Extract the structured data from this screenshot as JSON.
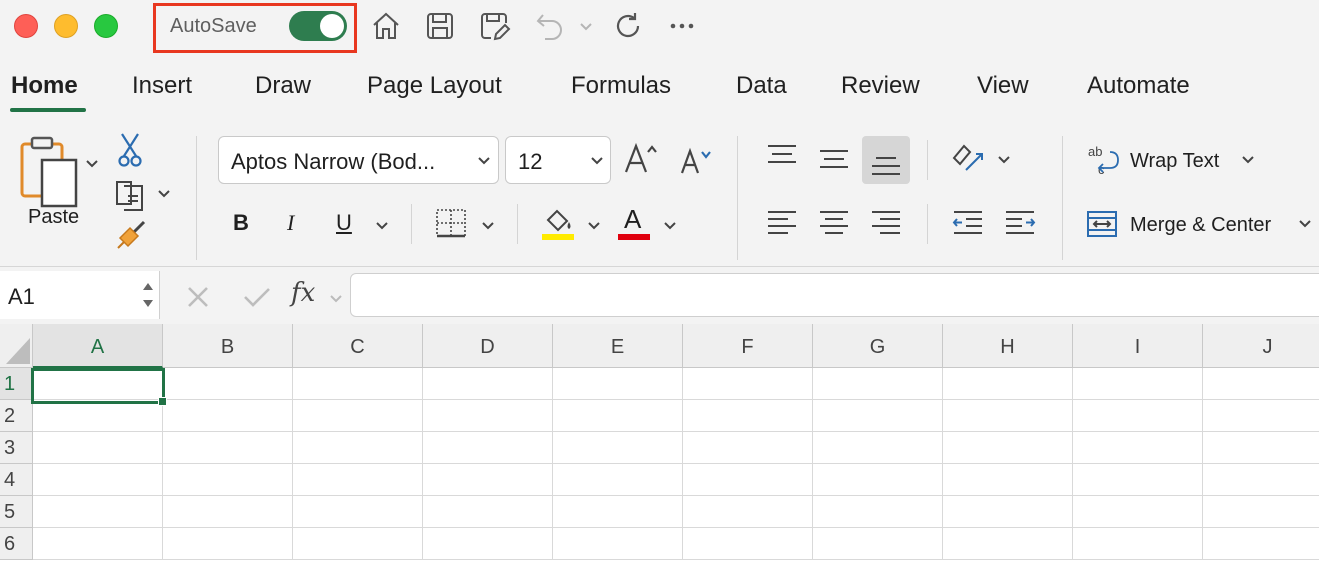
{
  "titlebar": {
    "autosave_label": "AutoSave",
    "autosave_on": true,
    "icons": [
      "home-icon",
      "save-icon",
      "save-as-icon",
      "undo-icon",
      "redo-icon",
      "more-icon"
    ]
  },
  "tabs": [
    "Home",
    "Insert",
    "Draw",
    "Page Layout",
    "Formulas",
    "Data",
    "Review",
    "View",
    "Automate"
  ],
  "ribbon": {
    "paste_label": "Paste",
    "font_name": "Aptos Narrow (Bod...",
    "font_size": "12",
    "bold": "B",
    "italic": "I",
    "underline": "U",
    "font_color_glyph": "A",
    "wrap_text_label": "Wrap Text",
    "merge_center_label": "Merge & Center",
    "fill_color": "#ffeb00",
    "font_color": "#e0000e"
  },
  "formula_bar": {
    "name_box": "A1",
    "fx_label": "fx",
    "formula": ""
  },
  "grid": {
    "columns": [
      "A",
      "B",
      "C",
      "D",
      "E",
      "F",
      "G",
      "H",
      "I",
      "J"
    ],
    "rows": [
      "1",
      "2",
      "3",
      "4",
      "5",
      "6"
    ],
    "active_cell": "A1"
  },
  "colors": {
    "accent": "#217346",
    "highlight_box": "#e8371f"
  }
}
